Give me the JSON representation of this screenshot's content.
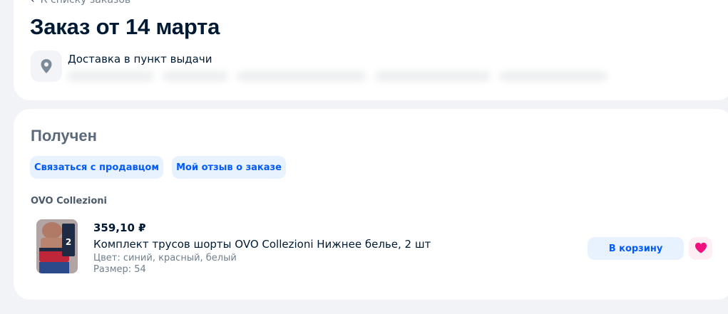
{
  "header": {
    "back_label": "К списку заказов",
    "title": "Заказ от 14 марта"
  },
  "delivery": {
    "label": "Доставка в пункт выдачи",
    "icon": "location-pin-icon"
  },
  "order": {
    "status": "Получен",
    "actions": {
      "contact_seller": "Связаться с продавцом",
      "my_review": "Мой отзыв о заказе"
    },
    "seller": "OVO Collezioni",
    "item": {
      "price": "359,10 ₽",
      "name": "Комплект трусов шорты OVO Collezioni Нижнее белье, 2 шт",
      "color": "Цвет: синий, красный, белый",
      "size": "Размер: 54",
      "add_to_cart": "В корзину",
      "favorite_icon": "heart-icon"
    }
  },
  "colors": {
    "accent": "#005bff",
    "accent_bg": "#e8f2ff",
    "favorite": "#f1117e",
    "favorite_bg": "#fdeef4"
  }
}
